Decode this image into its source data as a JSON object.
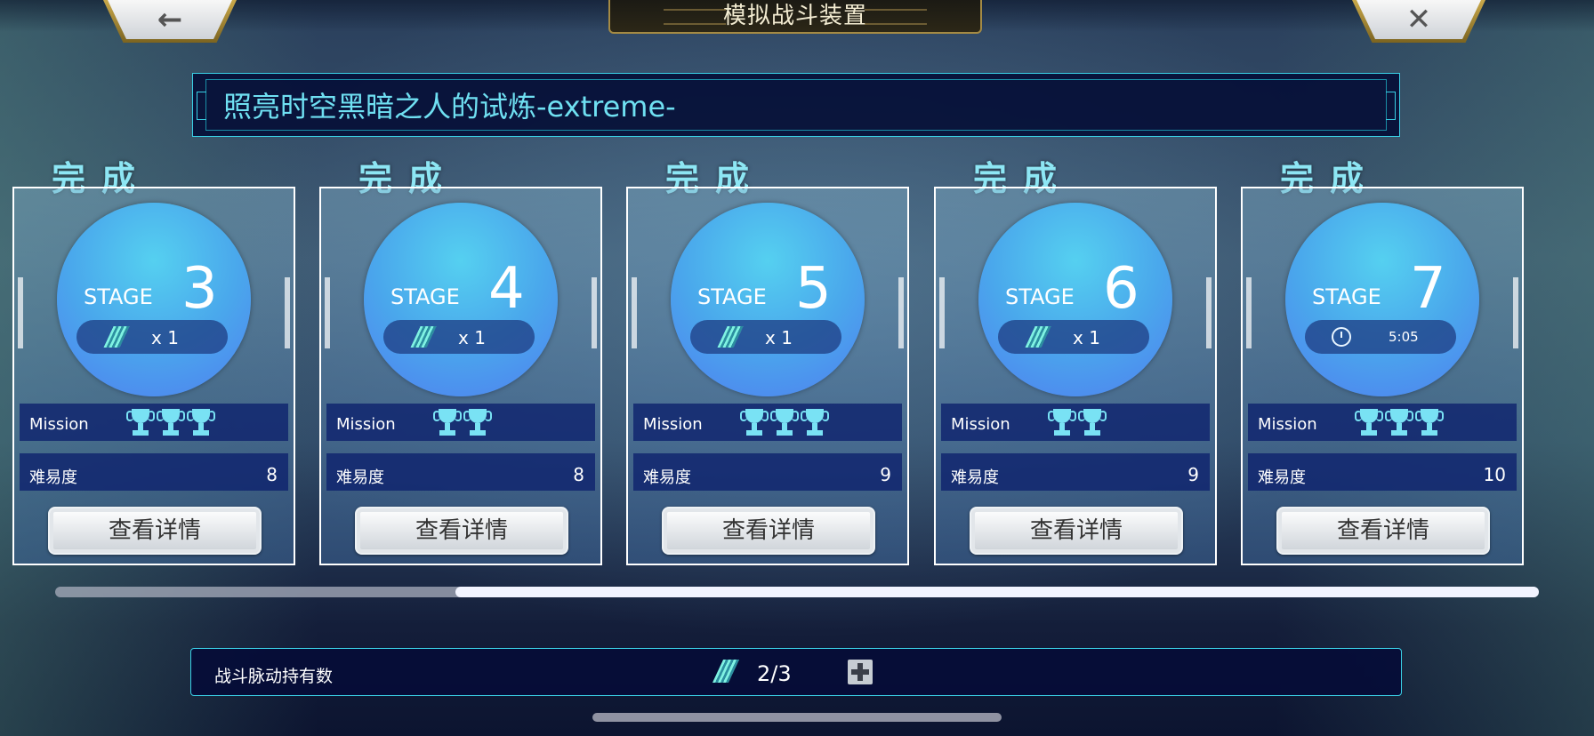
{
  "header": {
    "title": "模拟战斗装置",
    "back_icon": "←",
    "close_icon": "✕"
  },
  "banner": {
    "text": "照亮时空黑暗之人的试炼-extreme-"
  },
  "stages": [
    {
      "status": "完成",
      "stage_label": "STAGE",
      "number": "3",
      "cost_type": "ticket",
      "cost": "x 1",
      "mission_label": "Mission",
      "trophies": 3,
      "difficulty_label": "难易度",
      "difficulty": "8",
      "button": "查看详情"
    },
    {
      "status": "完成",
      "stage_label": "STAGE",
      "number": "4",
      "cost_type": "ticket",
      "cost": "x 1",
      "mission_label": "Mission",
      "trophies": 2,
      "difficulty_label": "难易度",
      "difficulty": "8",
      "button": "查看详情"
    },
    {
      "status": "完成",
      "stage_label": "STAGE",
      "number": "5",
      "cost_type": "ticket",
      "cost": "x 1",
      "mission_label": "Mission",
      "trophies": 3,
      "difficulty_label": "难易度",
      "difficulty": "9",
      "button": "查看详情"
    },
    {
      "status": "完成",
      "stage_label": "STAGE",
      "number": "6",
      "cost_type": "ticket",
      "cost": "x 1",
      "mission_label": "Mission",
      "trophies": 2,
      "difficulty_label": "难易度",
      "difficulty": "9",
      "button": "查看详情"
    },
    {
      "status": "完成",
      "stage_label": "STAGE",
      "number": "7",
      "cost_type": "timer",
      "cost": "5:05",
      "mission_label": "Mission",
      "trophies": 3,
      "difficulty_label": "难易度",
      "difficulty": "10",
      "button": "查看详情"
    }
  ],
  "scroll": {
    "thumb_start_fraction": 0.27,
    "thumb_end_fraction": 1.0
  },
  "resource": {
    "label": "战斗脉动持有数",
    "count": "2/3",
    "icon": "ticket-icon",
    "plus_icon": "plus-icon"
  },
  "colors": {
    "accent": "#3ad0e6",
    "stage_circle": "#4aa8ec",
    "trophy": "#79e2f4"
  }
}
